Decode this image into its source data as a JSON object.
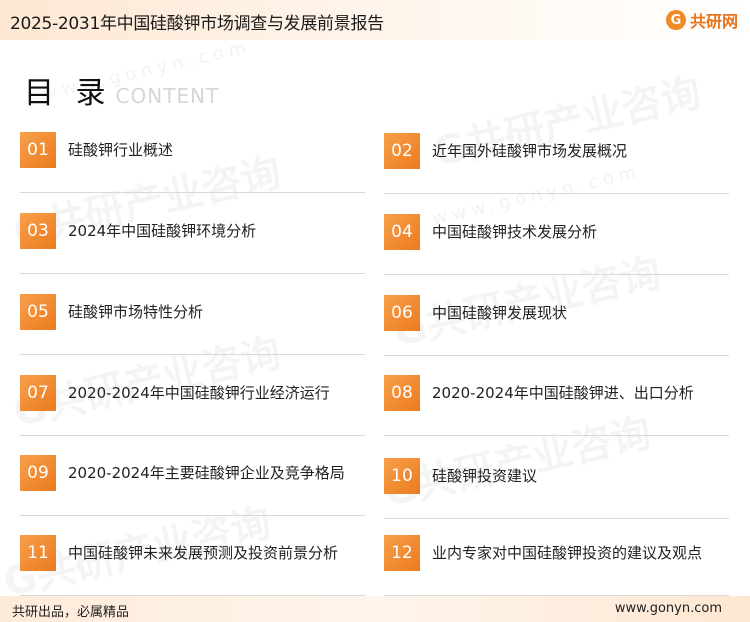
{
  "header": {
    "title": "2025-2031年中国硅酸钾市场调查与发展前景报告",
    "brand_mark": "G",
    "brand_name": "共研网"
  },
  "toc": {
    "title": "目 录",
    "subtitle": "CONTENT"
  },
  "watermark": {
    "text": "G共研产业咨询",
    "url": "www.gonyn.com"
  },
  "items": [
    {
      "num": "01",
      "label": "硅酸钾行业概述"
    },
    {
      "num": "02",
      "label": "近年国外硅酸钾市场发展概况"
    },
    {
      "num": "03",
      "label": "2024年中国硅酸钾环境分析"
    },
    {
      "num": "04",
      "label": "中国硅酸钾技术发展分析"
    },
    {
      "num": "05",
      "label": "硅酸钾市场特性分析"
    },
    {
      "num": "06",
      "label": "中国硅酸钾发展现状"
    },
    {
      "num": "07",
      "label": "2020-2024年中国硅酸钾行业经济运行"
    },
    {
      "num": "08",
      "label": "2020-2024年中国硅酸钾进、出口分析"
    },
    {
      "num": "09",
      "label": "2020-2024年主要硅酸钾企业及竞争格局"
    },
    {
      "num": "10",
      "label": "硅酸钾投资建议"
    },
    {
      "num": "11",
      "label": "中国硅酸钾未来发展预测及投资前景分析"
    },
    {
      "num": "12",
      "label": "业内专家对中国硅酸钾投资的建议及观点"
    }
  ],
  "footer": {
    "slogan": "共研出品，必属精品",
    "url": "www.gonyn.com"
  },
  "colors": {
    "accent": "#ec7a1e",
    "accent_light": "#f7a04b",
    "header_bg": "#fde7d2"
  }
}
